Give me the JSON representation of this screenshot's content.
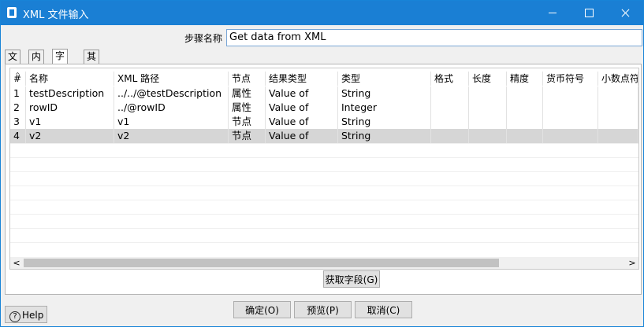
{
  "window": {
    "title": "XML 文件输入"
  },
  "step": {
    "label": "步骤名称",
    "value": "Get data from XML"
  },
  "tabs": [
    {
      "label": "文件"
    },
    {
      "label": "内容"
    },
    {
      "label": "字段"
    },
    {
      "label": "其他输出字段"
    }
  ],
  "table": {
    "headers": [
      "#",
      "名称",
      "XML 路径",
      "节点",
      "结果类型",
      "类型",
      "格式",
      "长度",
      "精度",
      "货币符号",
      "小数点符"
    ],
    "rows": [
      [
        "1",
        "testDescription",
        "../../@testDescription",
        "属性",
        "Value of",
        "String"
      ],
      [
        "2",
        "rowID",
        "../@rowID",
        "属性",
        "Value of",
        "Integer"
      ],
      [
        "3",
        "v1",
        "v1",
        "节点",
        "Value of",
        "String"
      ],
      [
        "4",
        "v2",
        "v2",
        "节点",
        "Value of",
        "String"
      ]
    ]
  },
  "buttons": {
    "get_fields": "获取字段(G)",
    "ok": "确定(O)",
    "preview": "预览(P)",
    "cancel": "取消(C)",
    "help": "Help"
  }
}
